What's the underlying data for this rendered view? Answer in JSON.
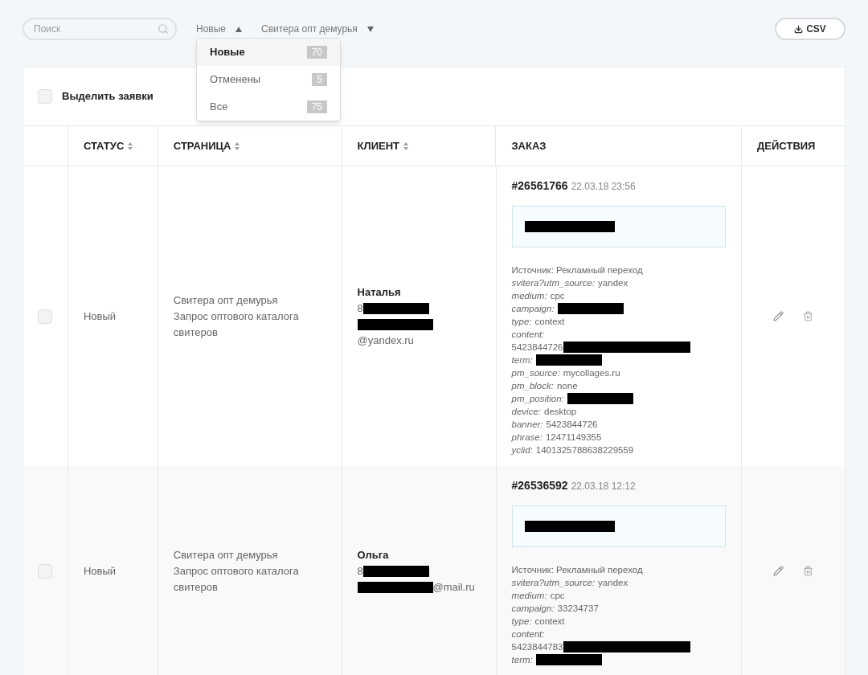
{
  "search": {
    "placeholder": "Поиск"
  },
  "filters": [
    {
      "label": "Новые",
      "expanded": true,
      "options": [
        {
          "label": "Новые",
          "count": "70",
          "selected": true
        },
        {
          "label": "Отменены",
          "count": "5",
          "selected": false
        },
        {
          "label": "Все",
          "count": "75",
          "selected": false
        }
      ]
    },
    {
      "label": "Свитера опт демурья",
      "expanded": false
    }
  ],
  "export_button": {
    "label": "CSV"
  },
  "select_all": {
    "label": "Выделить заявки",
    "checked": false
  },
  "table": {
    "columns": [
      {
        "label": "СТАТУС",
        "sortable": true
      },
      {
        "label": "СТРАНИЦА",
        "sortable": true
      },
      {
        "label": "КЛИЕНТ",
        "sortable": true
      },
      {
        "label": "ЗАКАЗ",
        "sortable": false
      },
      {
        "label": "ДЕЙСТВИЯ",
        "sortable": false
      }
    ],
    "rows": [
      {
        "checked": false,
        "status": "Новый",
        "page_title": "Свитера опт демурья",
        "page_subtitle": "Запрос оптового каталога свитеров",
        "client": {
          "name": "Наталья",
          "phone": "8",
          "phone_redacted": true,
          "email": "@yandex.ru",
          "email_redacted": true
        },
        "order": {
          "number": "#26561766",
          "date": "22.03.18 23:56",
          "note_redacted": true,
          "details": [
            {
              "kind": "plain",
              "text": "Источник: Рекламный переход"
            },
            {
              "kind": "field",
              "key": "svitera?utm_source:",
              "value": "yandex"
            },
            {
              "kind": "field",
              "key": "medium:",
              "value": "cpc"
            },
            {
              "kind": "field",
              "key": "campaign:",
              "redacted": true
            },
            {
              "kind": "field",
              "key": "type:",
              "value": "context"
            },
            {
              "kind": "field",
              "key": "content:"
            },
            {
              "kind": "plain",
              "text": "5423844726",
              "redacted": true
            },
            {
              "kind": "field",
              "key": "term:",
              "redacted": true
            },
            {
              "kind": "field",
              "key": "pm_source:",
              "value": "mycollages.ru"
            },
            {
              "kind": "field",
              "key": "pm_block:",
              "value": "none"
            },
            {
              "kind": "field",
              "key": "pm_position:",
              "redacted": true
            },
            {
              "kind": "field",
              "key": "device:",
              "value": "desktop"
            },
            {
              "kind": "field",
              "key": "banner:",
              "value": "5423844726"
            },
            {
              "kind": "field",
              "key": "phrase:",
              "value": "12471149355"
            },
            {
              "kind": "field",
              "key": "yclid:",
              "value": "1401325788638229559"
            }
          ]
        }
      },
      {
        "checked": false,
        "status": "Новый",
        "page_title": "Свитера опт демурья",
        "page_subtitle": "Запрос оптового каталога свитеров",
        "client": {
          "name": "Ольга",
          "phone": "8",
          "phone_redacted": true,
          "email": "@mail.ru",
          "email_redacted": true
        },
        "order": {
          "number": "#26536592",
          "date": "22.03.18 12:12",
          "note_redacted": true,
          "details": [
            {
              "kind": "plain",
              "text": "Источник: Рекламный переход"
            },
            {
              "kind": "field",
              "key": "svitera?utm_source:",
              "value": "yandex"
            },
            {
              "kind": "field",
              "key": "medium:",
              "value": "cpc"
            },
            {
              "kind": "field",
              "key": "campaign:",
              "value": "33234737"
            },
            {
              "kind": "field",
              "key": "type:",
              "value": "context"
            },
            {
              "kind": "field",
              "key": "content:"
            },
            {
              "kind": "plain",
              "text": "5423844783",
              "redacted": true
            },
            {
              "kind": "field",
              "key": "term:",
              "redacted": true
            }
          ]
        }
      }
    ]
  }
}
